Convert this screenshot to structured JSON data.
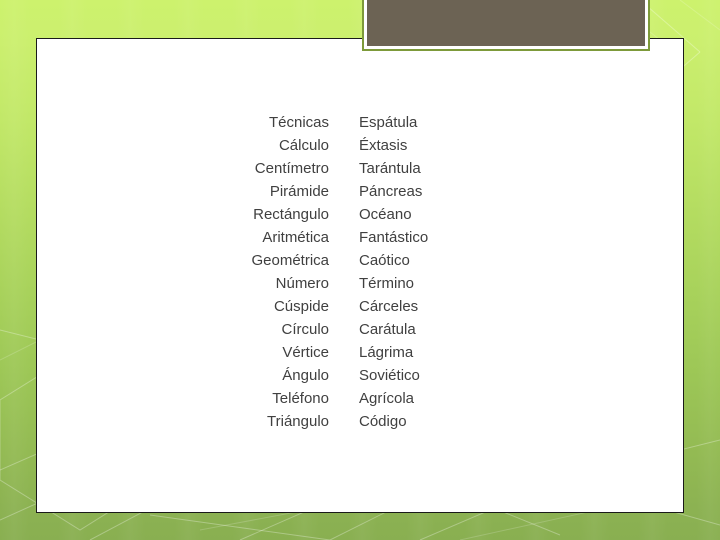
{
  "slide": {
    "background": {
      "gradient_top": "#cdf26d",
      "gradient_bottom": "#89af51",
      "pattern": "faint-diagonal-polygon-lines"
    },
    "content_frame": {
      "fill": "#ffffff",
      "border_color": "#1a1a1a"
    },
    "title_placeholder": {
      "text": "",
      "fill": "#6c6354",
      "border_color": "#7d9a3a",
      "inner_gap": "#ffffff"
    },
    "text_color": "#404040"
  },
  "word_table": {
    "columns": [
      "left",
      "right"
    ],
    "rows": [
      {
        "left": "Técnicas",
        "right": "Espátula"
      },
      {
        "left": "Cálculo",
        "right": "Éxtasis"
      },
      {
        "left": "Centímetro",
        "right": "Tarántula"
      },
      {
        "left": "Pirámide",
        "right": "Páncreas"
      },
      {
        "left": "Rectángulo",
        "right": "Océano"
      },
      {
        "left": "Aritmética",
        "right": "Fantástico"
      },
      {
        "left": "Geométrica",
        "right": "Caótico"
      },
      {
        "left": "Número",
        "right": "Término"
      },
      {
        "left": "Cúspide",
        "right": "Cárceles"
      },
      {
        "left": "Círculo",
        "right": "Carátula"
      },
      {
        "left": "Vértice",
        "right": "Lágrima"
      },
      {
        "left": "Ángulo",
        "right": "Soviético"
      },
      {
        "left": "Teléfono",
        "right": "Agrícola"
      },
      {
        "left": "Triángulo",
        "right": "Código"
      }
    ]
  }
}
